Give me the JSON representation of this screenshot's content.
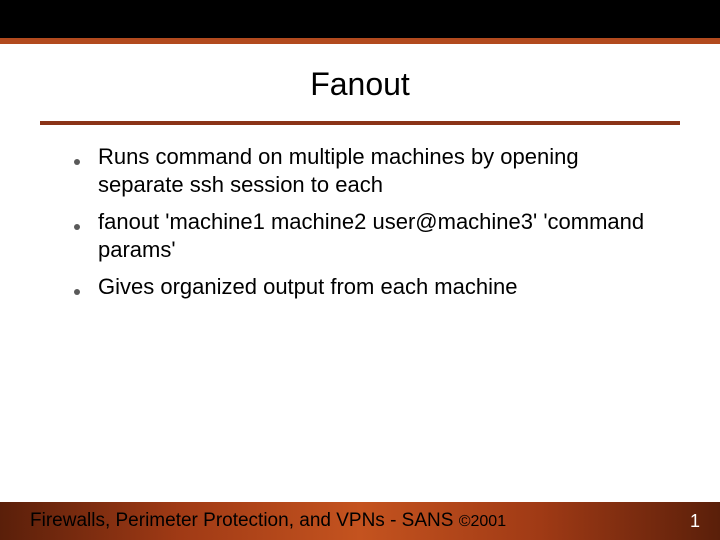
{
  "title": "Fanout",
  "bullets": [
    "Runs command on multiple machines by opening separate ssh session to each",
    "fanout 'machine1 machine2 user@machine3' 'command params'",
    "Gives organized output from each machine"
  ],
  "footer": {
    "text": "Firewalls, Perimeter Protection, and VPNs - SANS ",
    "copyright": "©2001"
  },
  "page_number": "1"
}
